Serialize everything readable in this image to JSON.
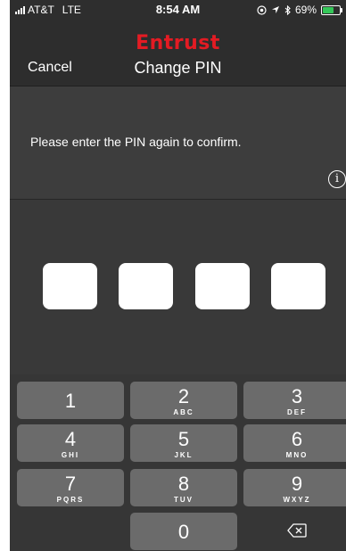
{
  "status_bar": {
    "carrier": "AT&T",
    "network": "LTE",
    "time": "8:54 AM",
    "battery": "69%",
    "battery_level": 0.69,
    "icons": [
      "signal-icon",
      "location-lock-icon",
      "location-arrow-icon",
      "bluetooth-icon",
      "battery-icon"
    ]
  },
  "header": {
    "logo_text": "Entrust",
    "cancel_label": "Cancel",
    "title": "Change PIN"
  },
  "message": {
    "prompt": "Please enter the PIN again to confirm.",
    "info_icon": "info-icon"
  },
  "pin": {
    "length": 4,
    "entered": 0
  },
  "keypad": {
    "keys": [
      {
        "digit": "1",
        "letters": ""
      },
      {
        "digit": "2",
        "letters": "ABC"
      },
      {
        "digit": "3",
        "letters": "DEF"
      },
      {
        "digit": "4",
        "letters": "GHI"
      },
      {
        "digit": "5",
        "letters": "JKL"
      },
      {
        "digit": "6",
        "letters": "MNO"
      },
      {
        "digit": "7",
        "letters": "PQRS"
      },
      {
        "digit": "8",
        "letters": "TUV"
      },
      {
        "digit": "9",
        "letters": "WXYZ"
      },
      {
        "digit": "0",
        "letters": ""
      }
    ],
    "delete_icon": "backspace-icon"
  },
  "colors": {
    "brand": "#e31b23",
    "background": "#3d3d3d",
    "key": "#6b6b6b",
    "battery": "#35c759",
    "annotation": "#d0021b"
  }
}
